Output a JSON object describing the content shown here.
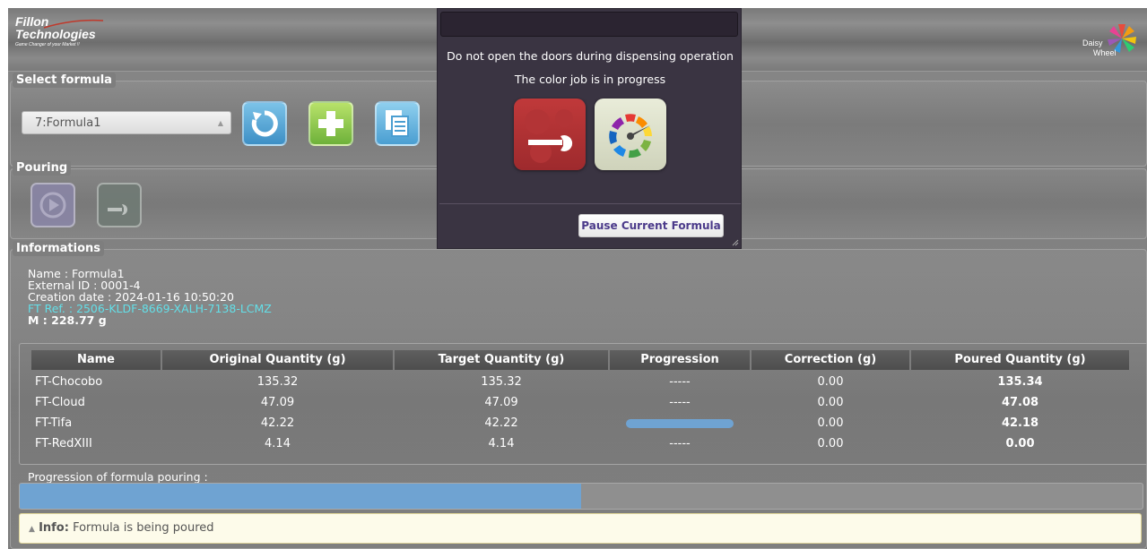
{
  "brand": {
    "line1": "Fillon",
    "line2": "Technologies",
    "tagline": "Game Changer of your Market !!",
    "product_line1": "Daisy",
    "product_line2": "Wheel"
  },
  "select_formula": {
    "legend": "Select formula",
    "selected": "7:Formula1",
    "buttons": [
      "reset-icon",
      "add-icon",
      "copy-document-icon"
    ]
  },
  "pouring": {
    "legend": "Pouring",
    "buttons": [
      "play-icon",
      "wrench-icon"
    ]
  },
  "informations": {
    "legend": "Informations",
    "name": "Name : Formula1",
    "external_id": "External ID : 0001-4",
    "creation_date": "Creation date : 2024-01-16 10:50:20",
    "ft_ref": "FT Ref. : 2506-KLDF-8669-XALH-7138-LCMZ",
    "mass": "M : 228.77 g"
  },
  "table": {
    "headers": [
      "Name",
      "Original Quantity (g)",
      "Target Quantity (g)",
      "Progression",
      "Correction (g)",
      "Poured Quantity (g)"
    ],
    "rows": [
      {
        "name": "FT-Chocobo",
        "original": "135.32",
        "target": "135.32",
        "progression": "-----",
        "correction": "0.00",
        "poured": "135.34"
      },
      {
        "name": "FT-Cloud",
        "original": "47.09",
        "target": "47.09",
        "progression": "-----",
        "correction": "0.00",
        "poured": "47.08"
      },
      {
        "name": "FT-Tifa",
        "original": "42.22",
        "target": "42.22",
        "progression": "",
        "progression_fraction": 1.0,
        "correction": "0.00",
        "poured": "42.18"
      },
      {
        "name": "FT-RedXIII",
        "original": "4.14",
        "target": "4.14",
        "progression": "-----",
        "correction": "0.00",
        "poured": "0.00"
      }
    ]
  },
  "overall_progress": {
    "label": "Progression of formula pouring :",
    "fraction": 0.5
  },
  "alert": {
    "prefix": "Info:",
    "message": " Formula is being poured"
  },
  "dialog": {
    "title": "",
    "line1": "Do not open the doors during dispensing operation",
    "line2": "The color job is in progress",
    "icons": [
      "maintenance-gear-icon",
      "color-gauge-icon"
    ],
    "pause_label": "Pause Current Formula"
  },
  "colors": {
    "accent_blue": "#6fa3d2",
    "ft_ref": "#63dfe8",
    "dialog_bg": "#3a3442",
    "pause_text": "#4b3a8a"
  }
}
